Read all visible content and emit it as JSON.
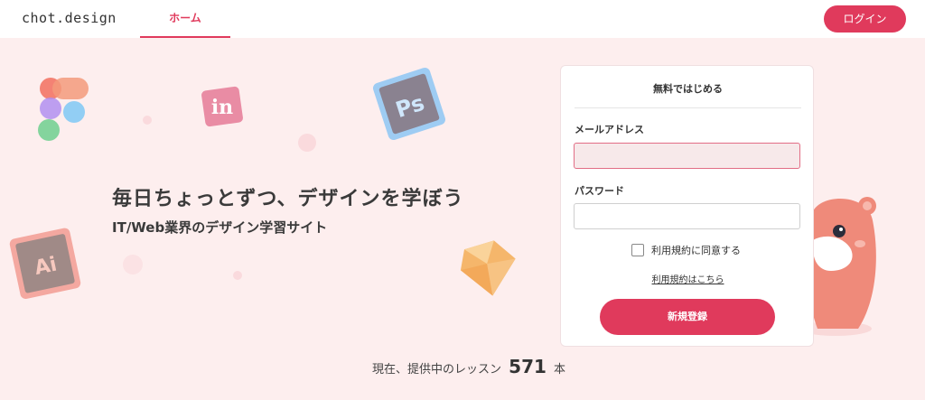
{
  "header": {
    "logo": "chot.design",
    "nav_home": "ホーム",
    "login_label": "ログイン"
  },
  "hero": {
    "headline": "毎日ちょっとずつ、デザインを学ぼう",
    "subline": "IT/Web業界のデザイン学習サイト",
    "lesson_prefix": "現在、提供中のレッスン",
    "lesson_count": "571",
    "lesson_suffix": "本",
    "decor_icons": [
      "figma-icon",
      "invision-icon",
      "photoshop-icon",
      "illustrator-icon",
      "sketch-icon",
      "hamster-mascot"
    ]
  },
  "signup": {
    "title": "無料ではじめる",
    "email_label": "メールアドレス",
    "email_value": "",
    "password_label": "パスワード",
    "password_value": "",
    "agree_label": "利用規約に同意する",
    "terms_link": "利用規約はこちら",
    "submit_label": "新規登録"
  },
  "colors": {
    "accent": "#e03a5c",
    "background": "#fdeeee"
  }
}
